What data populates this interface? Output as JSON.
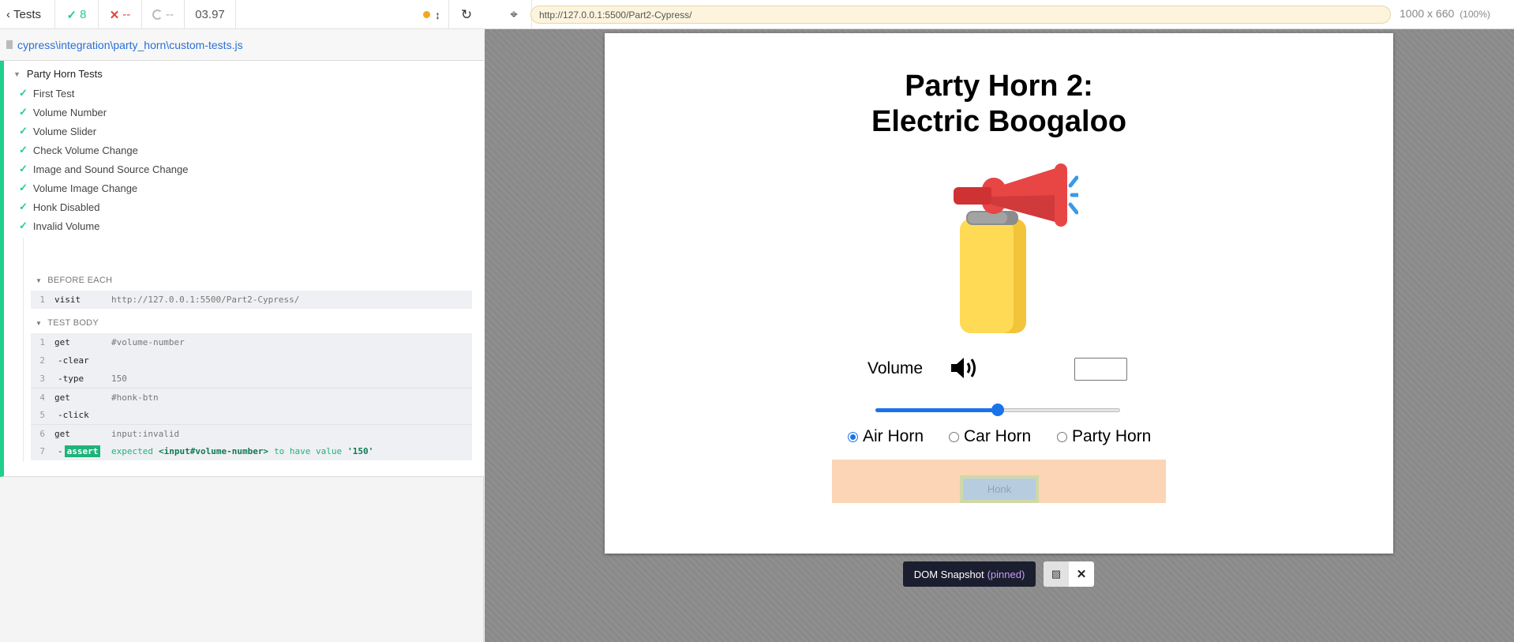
{
  "reporter": {
    "back_label": "Tests",
    "passed": "8",
    "failed": "--",
    "pending": "--",
    "duration": "03.97",
    "spec_path": "cypress\\integration\\party_horn\\custom-tests.js",
    "suite_title": "Party Horn Tests",
    "tests": [
      "First Test",
      "Volume Number",
      "Volume Slider",
      "Check Volume Change",
      "Image and Sound Source Change",
      "Volume Image Change",
      "Honk Disabled",
      "Invalid Volume"
    ],
    "before_each_label": "BEFORE EACH",
    "test_body_label": "TEST BODY",
    "before_each_cmds": [
      {
        "num": "1",
        "name": "visit",
        "msg": "http://127.0.0.1:5500/Part2-Cypress/"
      }
    ],
    "body_cmds": [
      {
        "num": "1",
        "name": "get",
        "msg": "#volume-number"
      },
      {
        "num": "2",
        "name": "-clear",
        "msg": ""
      },
      {
        "num": "3",
        "name": "-type",
        "msg": "150"
      },
      {
        "num": "4",
        "name": "get",
        "msg": "#honk-btn"
      },
      {
        "num": "5",
        "name": "-click",
        "msg": ""
      },
      {
        "num": "6",
        "name": "get",
        "msg": "input:invalid"
      }
    ],
    "assert_cmd": {
      "num": "7",
      "prefix": "-",
      "name": "assert",
      "msg_a": "expected",
      "msg_b": "<input#volume-number>",
      "msg_c": "to have value",
      "msg_d": "'150'"
    }
  },
  "aut": {
    "url": "http://127.0.0.1:5500/Part2-Cypress/",
    "viewport_size": "1000 x 660",
    "viewport_scale": "(100%)",
    "app": {
      "title_line1": "Party Horn 2:",
      "title_line2": "Electric Boogaloo",
      "volume_label": "Volume",
      "volume_value": "",
      "slider_fraction": 0.5,
      "radios": [
        {
          "label": "Air Horn",
          "checked": true
        },
        {
          "label": "Car Horn",
          "checked": false
        },
        {
          "label": "Party Horn",
          "checked": false
        }
      ],
      "honk_label": "Honk"
    },
    "snapshot_label": "DOM Snapshot",
    "snapshot_state": "(pinned)"
  },
  "colors": {
    "pass": "#1fcf8c",
    "fail": "#e0433b",
    "accent": "#2a6fd6",
    "running_dot": "#f4a623"
  }
}
